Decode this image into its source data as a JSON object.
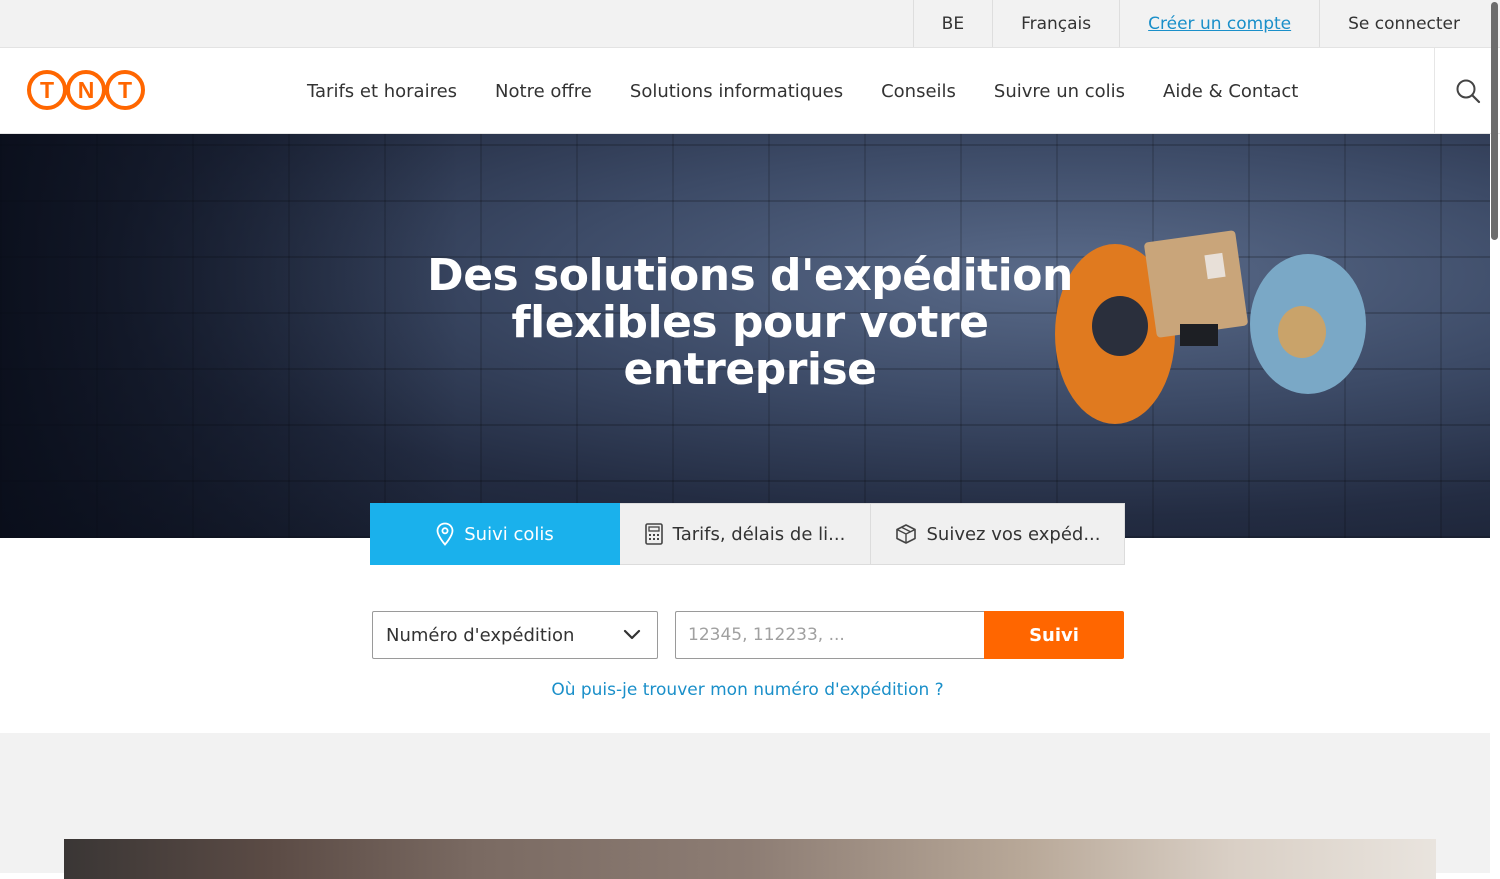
{
  "topbar": {
    "country": "BE",
    "language": "Français",
    "create_account": "Créer un compte",
    "login": "Se connecter"
  },
  "nav": {
    "items": [
      {
        "label": "Tarifs et horaires"
      },
      {
        "label": "Notre offre"
      },
      {
        "label": "Solutions informatiques"
      },
      {
        "label": "Conseils"
      },
      {
        "label": "Suivre un colis"
      },
      {
        "label": "Aide & Contact"
      }
    ],
    "search_icon": "search-icon"
  },
  "logo": {
    "letters": [
      "T",
      "N",
      "T"
    ],
    "color": "#ff6600"
  },
  "hero": {
    "title": "Des solutions d'expédition flexibles pour votre entreprise"
  },
  "tabs": [
    {
      "label": "Suivi colis",
      "icon": "location-pin-icon",
      "active": true
    },
    {
      "label": "Tarifs, délais de li...",
      "icon": "calculator-icon",
      "active": false
    },
    {
      "label": "Suivez vos expéd...",
      "icon": "package-icon",
      "active": false
    }
  ],
  "tracking": {
    "select_value": "Numéro d'expédition",
    "input_placeholder": "12345, 112233, ...",
    "button_label": "Suivi",
    "help_link": "Où puis-je trouver mon numéro d'expédition ?"
  },
  "colors": {
    "brand_orange": "#ff6600",
    "active_tab_blue": "#1ab1ec",
    "link_blue": "#1a8fc9"
  }
}
